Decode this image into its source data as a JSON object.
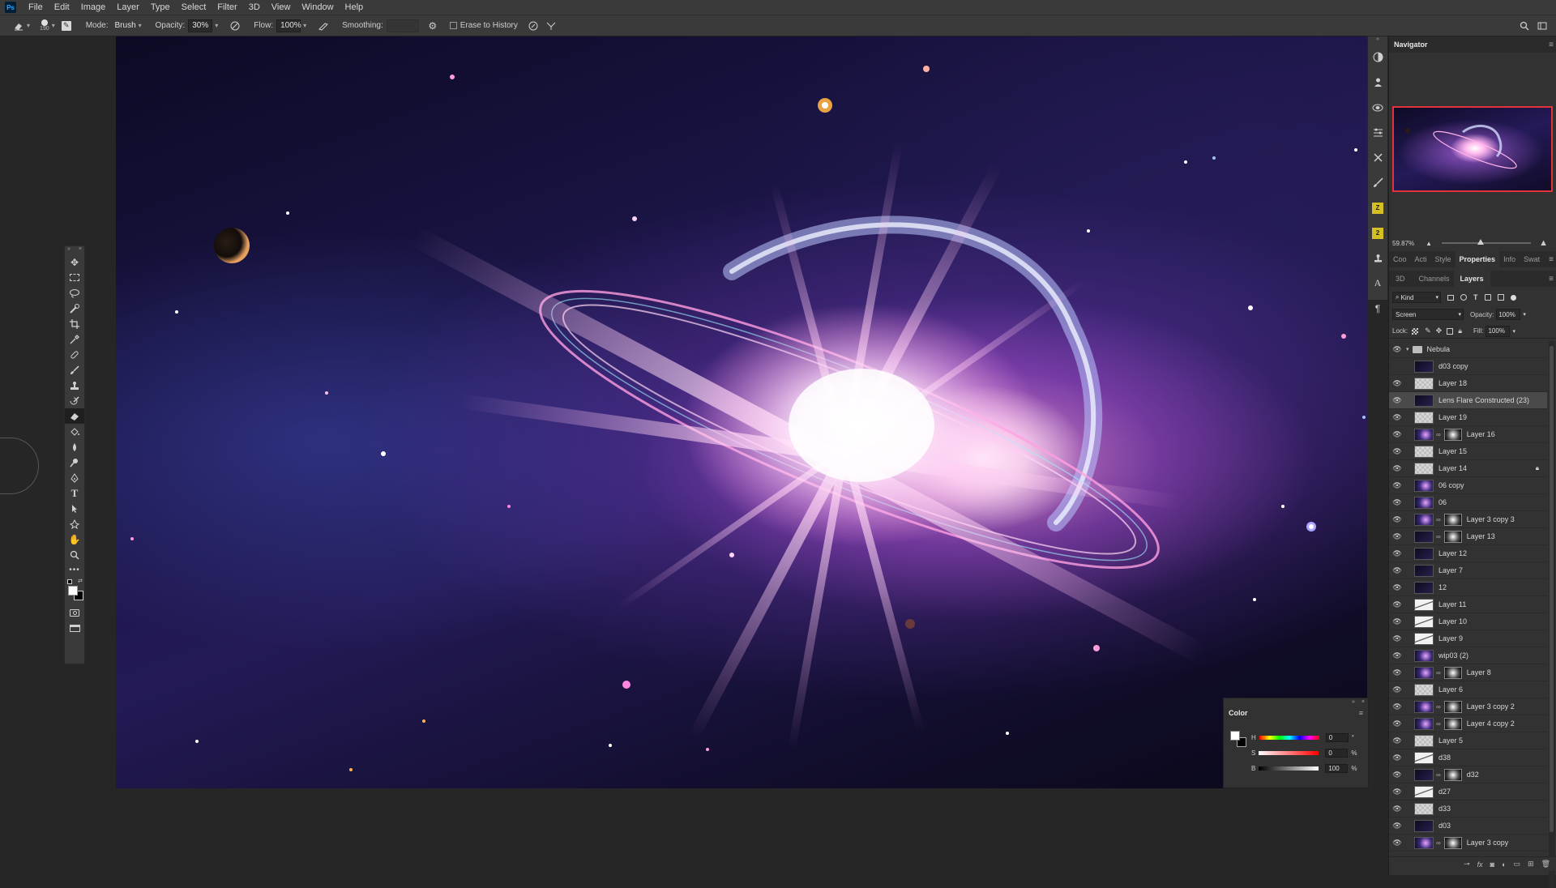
{
  "menubar": {
    "logo": "Ps",
    "items": [
      "File",
      "Edit",
      "Image",
      "Layer",
      "Type",
      "Select",
      "Filter",
      "3D",
      "View",
      "Window",
      "Help"
    ]
  },
  "options": {
    "brush_size": "190",
    "mode_label": "Mode:",
    "mode_value": "Brush",
    "opacity_label": "Opacity:",
    "opacity_value": "30%",
    "flow_label": "Flow:",
    "flow_value": "100%",
    "smoothing_label": "Smoothing:",
    "erase_history_label": "Erase to History"
  },
  "toolbar": {
    "tools": [
      "move-tool",
      "marquee-tool",
      "lasso-tool",
      "quick-select-tool",
      "crop-tool",
      "eyedropper-tool",
      "healing-tool",
      "brush-tool",
      "stamp-tool",
      "history-brush-tool",
      "eraser-tool",
      "paint-bucket-tool",
      "blur-tool",
      "dodge-tool",
      "pen-tool",
      "type-tool",
      "path-select-tool",
      "shape-tool",
      "hand-tool",
      "zoom-tool",
      "more-tools"
    ]
  },
  "navigator": {
    "title": "Navigator",
    "zoom": "59.87%"
  },
  "panel_tabs_top": [
    "Coo",
    "Acti",
    "Style",
    "Properties",
    "Info",
    "Swat"
  ],
  "panel_tabs_layers": [
    "3D",
    "Channels",
    "Layers"
  ],
  "layers_panel": {
    "filter_label": "Kind",
    "blend_mode": "Screen",
    "opacity_label": "Opacity:",
    "opacity_value": "100%",
    "lock_label": "Lock:",
    "fill_label": "Fill:",
    "fill_value": "100%",
    "group_name": "Nebula",
    "layers": [
      {
        "name": "d03 copy",
        "visible": false
      },
      {
        "name": "Layer 18",
        "visible": true
      },
      {
        "name": "Lens Flare Constructed (23)",
        "visible": true,
        "selected": true
      },
      {
        "name": "Layer 19",
        "visible": true
      },
      {
        "name": "Layer 16",
        "visible": true,
        "mask": true
      },
      {
        "name": "Layer 15",
        "visible": true
      },
      {
        "name": "Layer 14",
        "visible": true,
        "locked": true
      },
      {
        "name": "06 copy",
        "visible": true
      },
      {
        "name": "06",
        "visible": true
      },
      {
        "name": "Layer 3 copy 3",
        "visible": true,
        "mask": true
      },
      {
        "name": "Layer 13",
        "visible": true,
        "mask": true
      },
      {
        "name": "Layer 12",
        "visible": true
      },
      {
        "name": "Layer 7",
        "visible": true
      },
      {
        "name": "12",
        "visible": true
      },
      {
        "name": "Layer 11",
        "visible": true
      },
      {
        "name": "Layer 10",
        "visible": true
      },
      {
        "name": "Layer 9",
        "visible": true
      },
      {
        "name": "wip03 (2)",
        "visible": true
      },
      {
        "name": "Layer 8",
        "visible": true,
        "mask": true
      },
      {
        "name": "Layer 6",
        "visible": true
      },
      {
        "name": "Layer 3 copy 2",
        "visible": true,
        "mask": true
      },
      {
        "name": "Layer 4 copy 2",
        "visible": true,
        "mask": true
      },
      {
        "name": "Layer 5",
        "visible": true
      },
      {
        "name": "d38",
        "visible": true
      },
      {
        "name": "d32",
        "visible": true,
        "mask": true
      },
      {
        "name": "d27",
        "visible": true
      },
      {
        "name": "d33",
        "visible": true
      },
      {
        "name": "d03",
        "visible": true
      },
      {
        "name": "Layer 3 copy",
        "visible": true,
        "mask": true
      }
    ]
  },
  "color_panel": {
    "title": "Color",
    "h_label": "H",
    "h_value": "0",
    "h_unit": "°",
    "s_label": "S",
    "s_value": "0",
    "s_unit": "%",
    "b_label": "B",
    "b_value": "100",
    "b_unit": "%"
  },
  "colors": {
    "app_bg": "#262626",
    "panel_bg": "#323232",
    "bar_bg": "#3a3a3a",
    "navigator_frame": "#e0343a"
  }
}
